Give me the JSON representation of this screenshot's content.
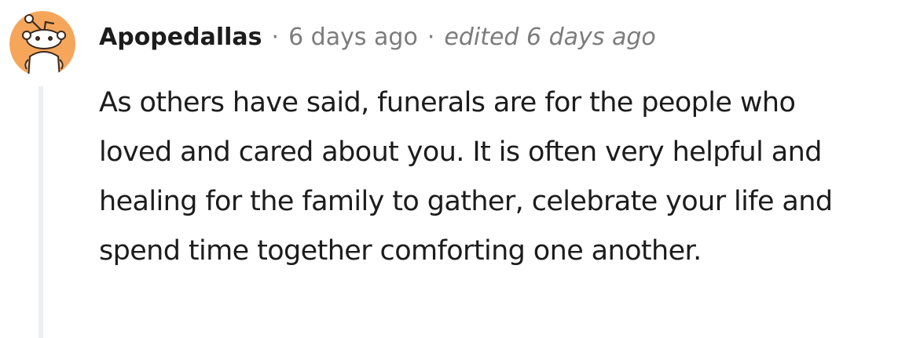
{
  "comment": {
    "author": "Apopedallas",
    "separator": "·",
    "timestamp": "6 days ago",
    "edited": "edited 6 days ago",
    "avatar_icon": "snoo-avatar-icon",
    "avatar_color": "#f5a65b",
    "body": "As others have said, funerals are for the people who loved and cared about you. It is often very helpful and healing for the family to gather, celebrate your life and spend time together comforting one another."
  }
}
